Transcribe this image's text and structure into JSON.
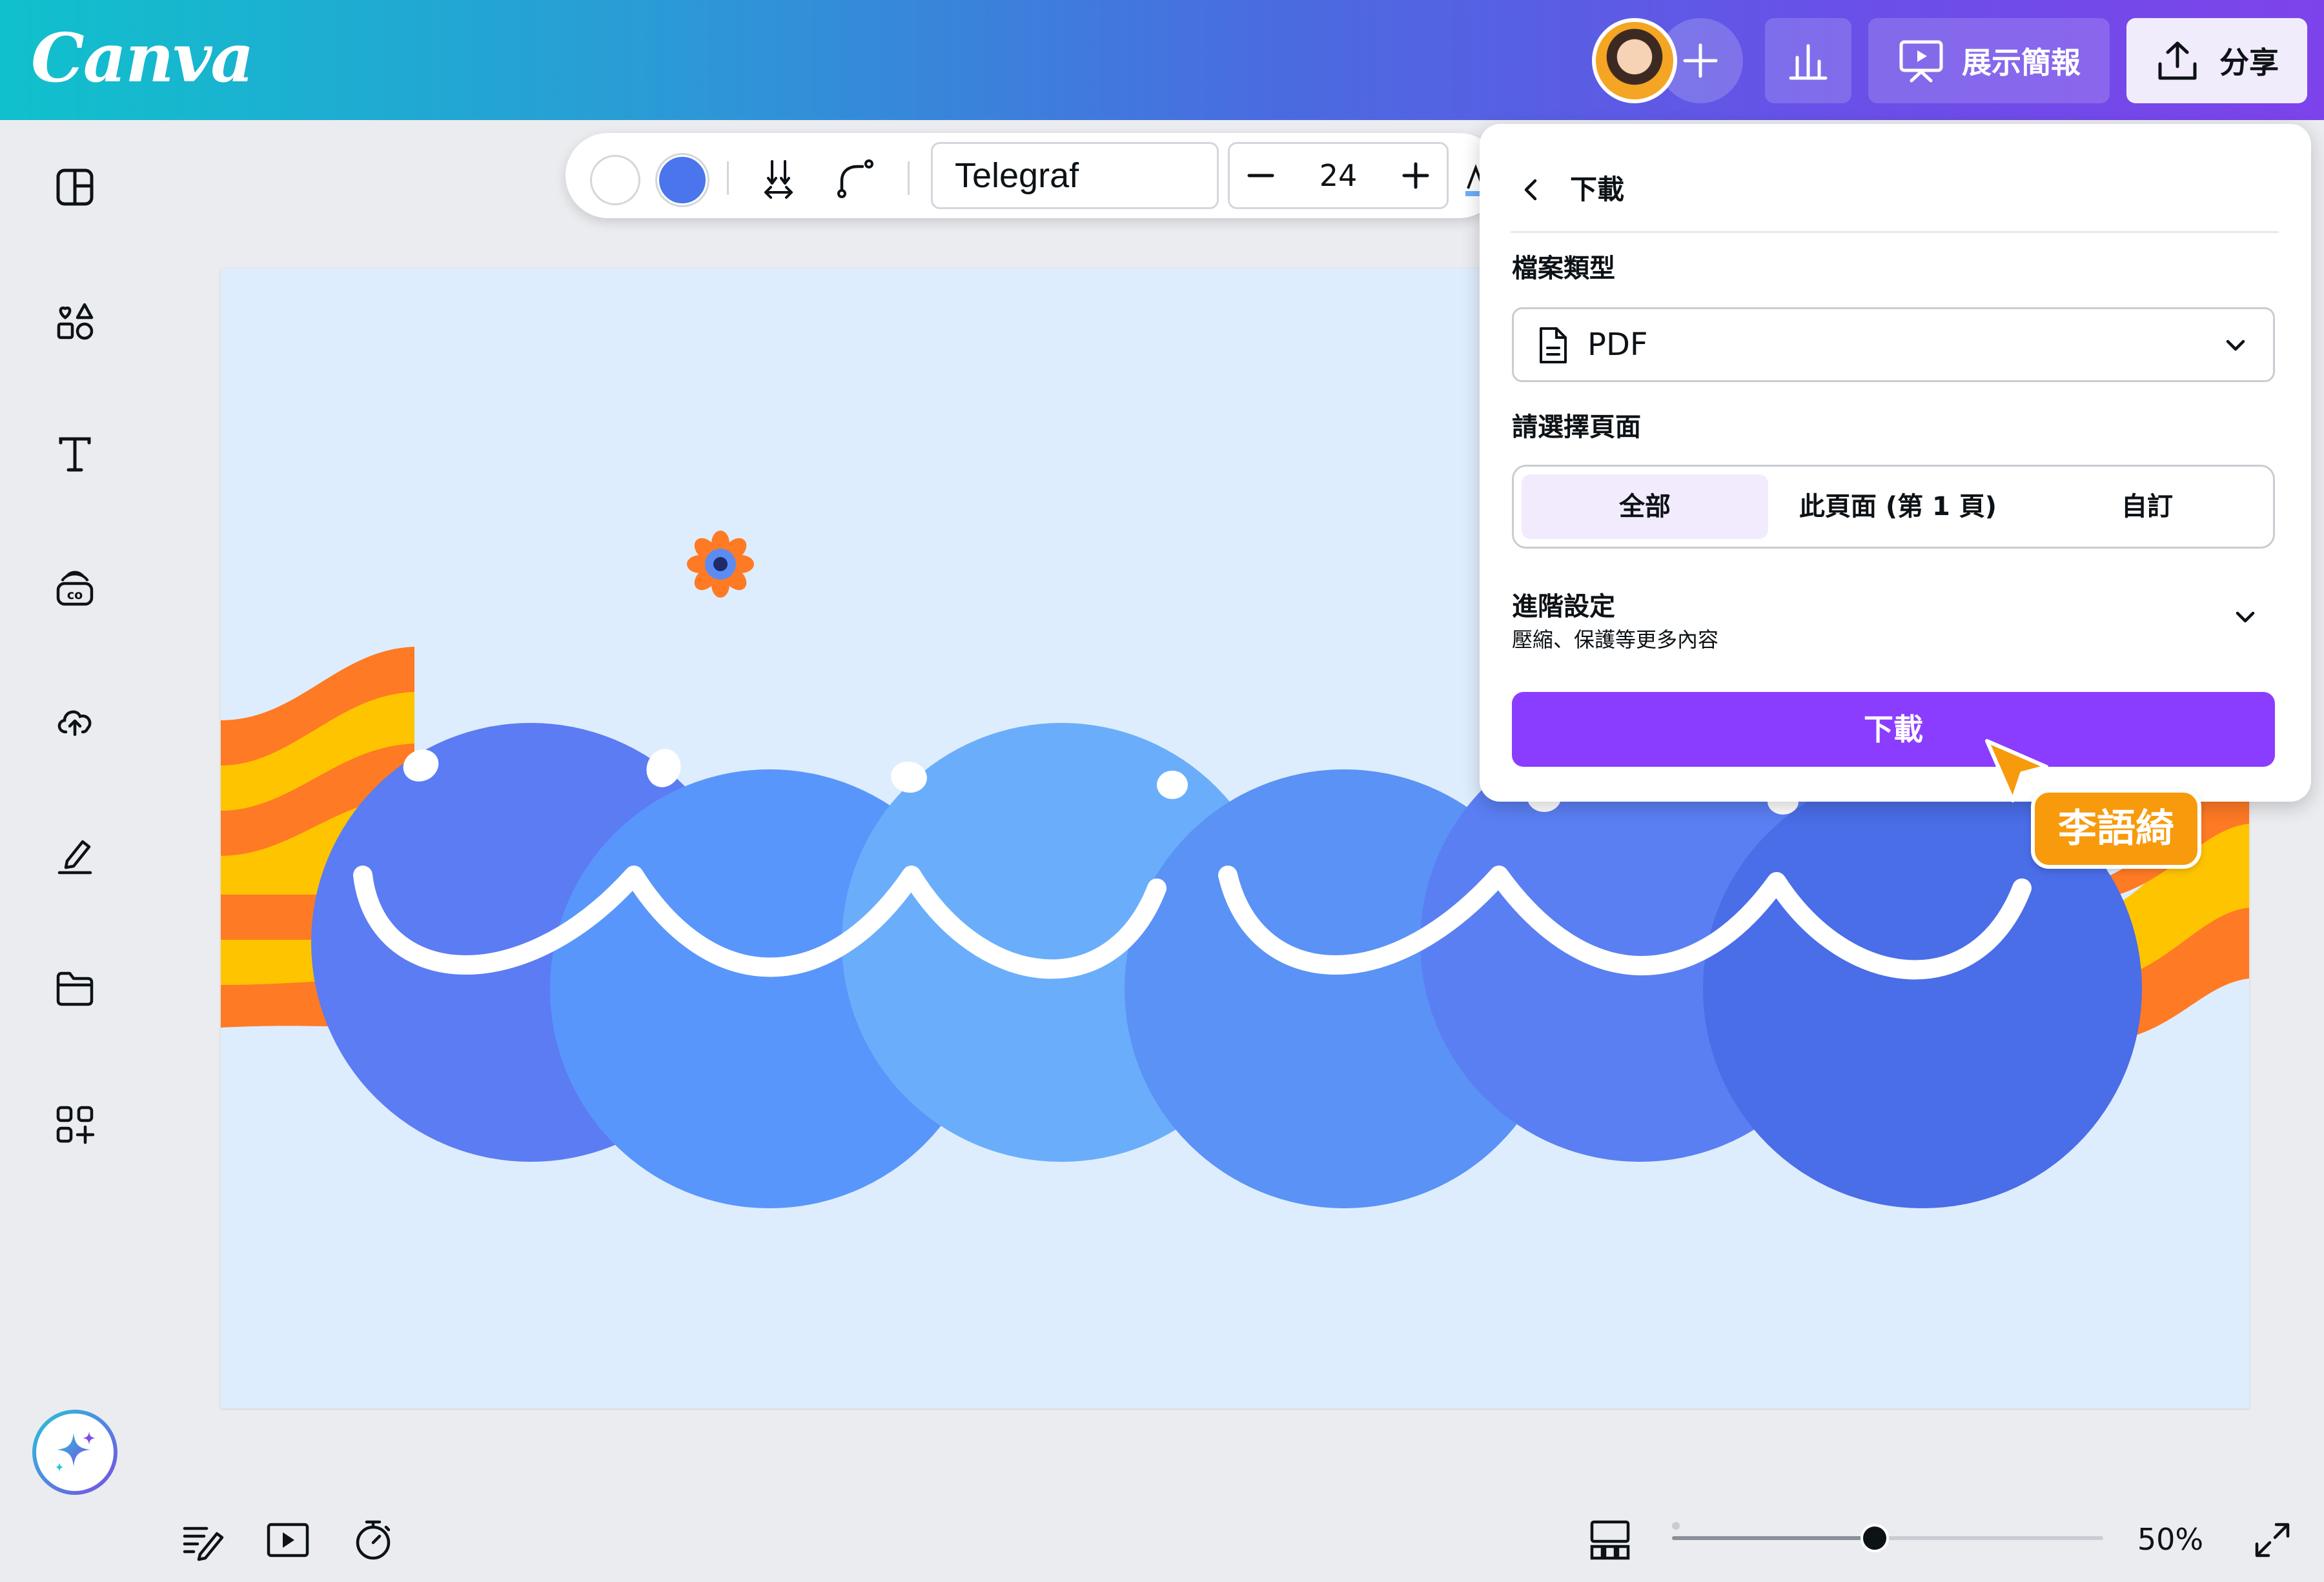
{
  "app": {
    "logo": "Canva",
    "brand_color": "#8b3dff"
  },
  "header": {
    "avatar_name": "avatar",
    "add_collaborator_icon": "plus-icon",
    "stats_icon": "bar-chart-icon",
    "present_label": "展示簡報",
    "present_icon": "presentation-icon",
    "share_label": "分享",
    "share_icon": "upload-icon"
  },
  "sidebar": {
    "items": [
      {
        "name": "design",
        "icon": "layout-icon"
      },
      {
        "name": "elements",
        "icon": "shapes-icon"
      },
      {
        "name": "text",
        "icon": "text-icon"
      },
      {
        "name": "brand",
        "icon": "brand-icon"
      },
      {
        "name": "uploads",
        "icon": "cloud-upload-icon"
      },
      {
        "name": "draw",
        "icon": "draw-icon"
      },
      {
        "name": "projects",
        "icon": "folder-icon"
      },
      {
        "name": "apps",
        "icon": "apps-icon"
      }
    ],
    "magic_icon": "sparkle-icon"
  },
  "toolbar": {
    "colors": [
      "#ffffff",
      "#4a75ec"
    ],
    "font": "Telegraf",
    "font_size": "24",
    "icons": [
      "spacing-icon",
      "curve-icon",
      "minus-icon",
      "plus-icon"
    ]
  },
  "canvas": {
    "background": "#deedfd",
    "face_colors": [
      "#5b7cf3",
      "#5896fb",
      "#6aaefb",
      "#5a92f6",
      "#5a7ff3",
      "#4a6de8"
    ],
    "stripe_colors": [
      "#ff7a24",
      "#ffc400"
    ]
  },
  "download_panel": {
    "title": "下載",
    "file_type_label": "檔案類型",
    "file_type_value": "PDF",
    "pages_label": "請選擇頁面",
    "pages_options": [
      "全部",
      "此頁面 (第 1 頁)",
      "自訂"
    ],
    "pages_selected": "全部",
    "advanced_title": "進階設定",
    "advanced_subtitle": "壓縮、保護等更多內容",
    "download_button": "下載"
  },
  "collaborator_cursor": {
    "name": "李語綺",
    "color": "#f79a0c"
  },
  "bottom_bar": {
    "icons": [
      "notes-icon",
      "play-icon",
      "timer-icon",
      "grid-view-icon",
      "fullscreen-icon"
    ],
    "zoom_label": "50%",
    "zoom_fraction": 0.47
  }
}
